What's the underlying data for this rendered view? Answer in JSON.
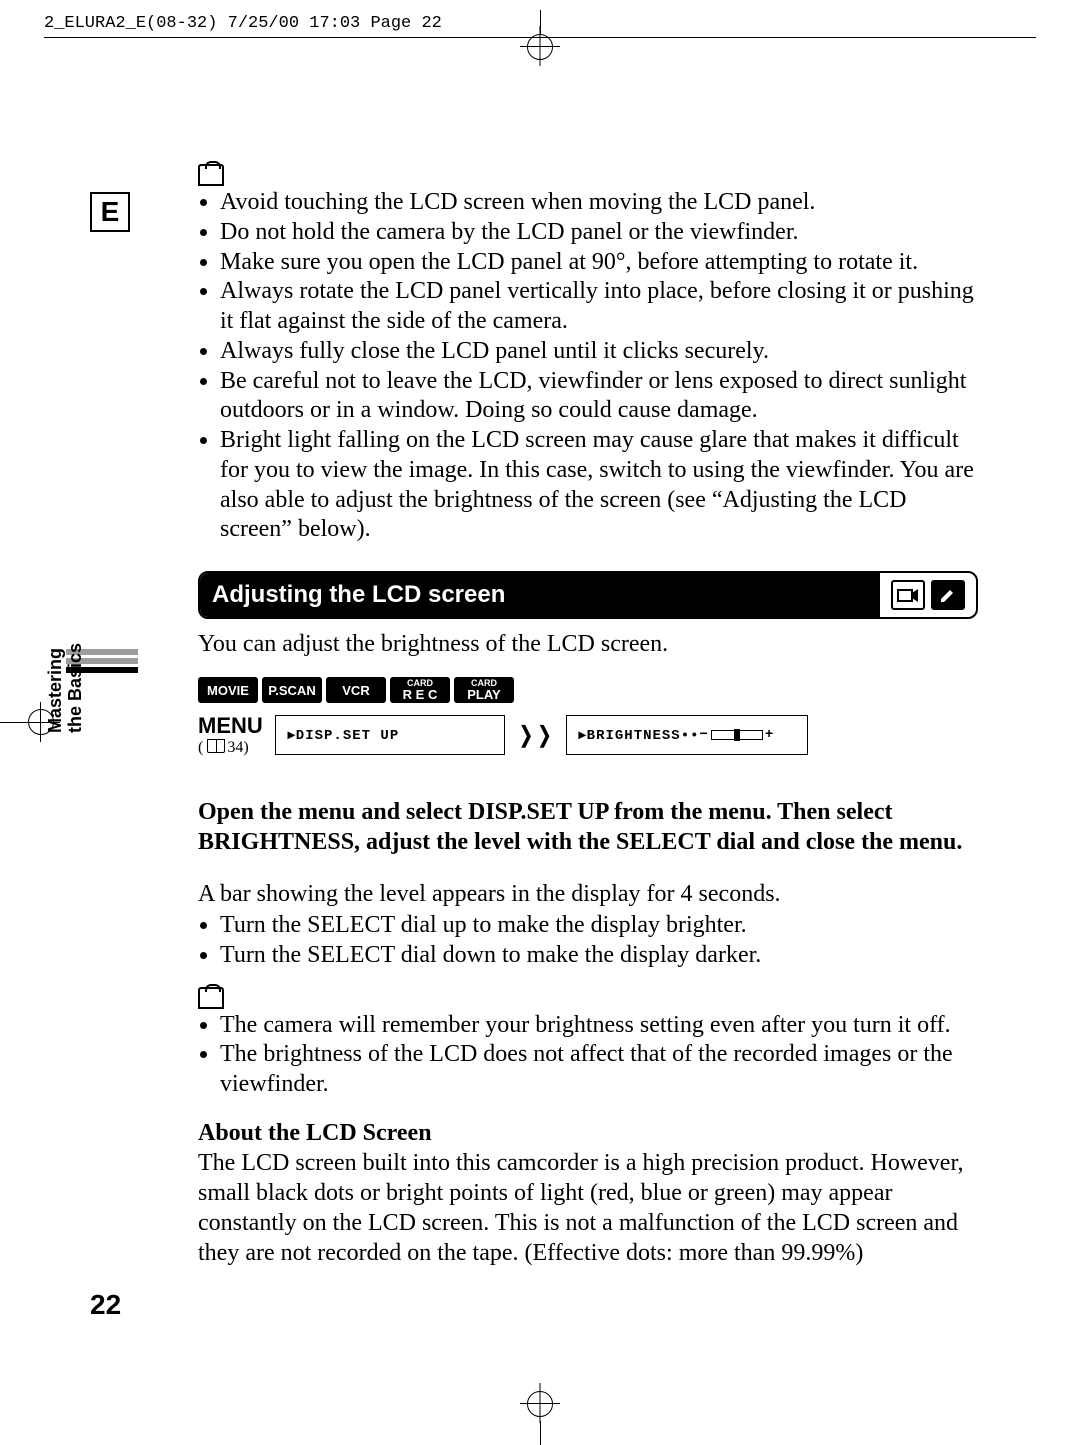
{
  "header": {
    "slug": "2_ELURA2_E(08-32)  7/25/00 17:03  Page 22"
  },
  "lang": "E",
  "section_tab": "Mastering\nthe Basics",
  "notes": [
    "Avoid touching the LCD screen when moving the LCD panel.",
    "Do not hold the camera by the LCD panel or the viewfinder.",
    "Make sure you open the LCD panel at 90°, before attempting to rotate it.",
    "Always rotate the LCD panel vertically into place, before closing it or pushing it flat against the side of the camera.",
    "Always fully close the LCD panel until it clicks securely.",
    "Be careful not to leave the LCD, viewfinder or lens exposed to direct sunlight outdoors or in a window. Doing so could cause damage.",
    "Bright light falling on the LCD screen may cause glare that makes it difficult for you to view the image. In this case, switch to using the viewfinder. You are also able to adjust the brightness of the screen (see “Adjusting the LCD screen” below)."
  ],
  "heading": "Adjusting the LCD screen",
  "intro": "You can adjust the brightness of the LCD screen.",
  "modes": {
    "m0": "MOVIE",
    "m1": "P.SCAN",
    "m2": "VCR",
    "m3_top": "CARD",
    "m3_bot": "R E C",
    "m4_top": "CARD",
    "m4_bot": "PLAY"
  },
  "menu": {
    "label": "MENU",
    "ref": "34)",
    "box1": "▸DISP.SET UP",
    "box2a": "▸BRIGHTNESS••",
    "box2b_minus": "−",
    "box2b_plus": "+"
  },
  "instruction": "Open the menu and select DISP.SET UP from the menu. Then select BRIGHTNESS, adjust the level with the SELECT dial and close the menu.",
  "bar_text": "A bar showing the level appears in the display for 4 seconds.",
  "dial": [
    "Turn the SELECT dial up to make the display brighter.",
    "Turn the SELECT dial down to make the display darker."
  ],
  "notes2": [
    "The camera will remember your brightness setting even after you turn it off.",
    "The brightness of the LCD does not affect that of the recorded images or the viewfinder."
  ],
  "about_head": "About the LCD Screen",
  "about_body": "The LCD screen built into this camcorder is a high precision product. However, small black dots or bright points of light (red, blue or green) may appear constantly on the LCD screen. This is not a malfunction of the LCD screen and they are not recorded on the tape. (Effective dots: more than 99.99%)",
  "page_num": "22"
}
